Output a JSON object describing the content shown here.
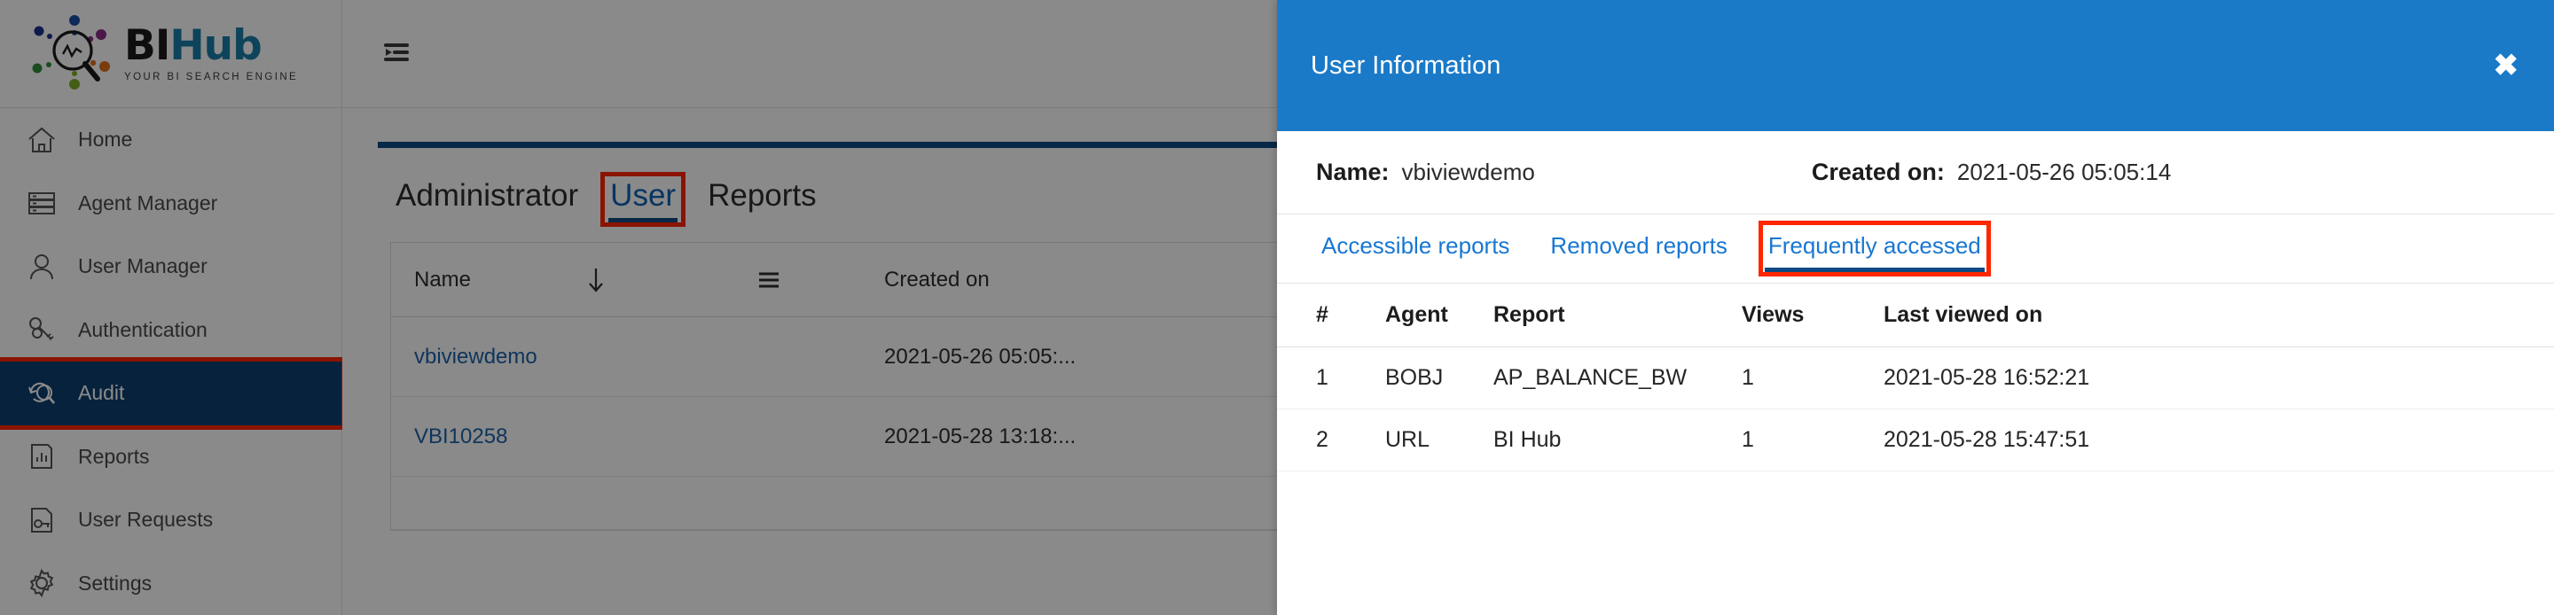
{
  "brand": {
    "name_bi": "BI",
    "name_hub": "Hub",
    "tagline": "YOUR BI SEARCH ENGINE",
    "logo_icon": "magnifier-analytics-icon"
  },
  "colors": {
    "accent_blue": "#1a7ac8",
    "nav_active": "#0e3f70",
    "rule_blue": "#0e4a84",
    "link_blue": "#1d63ab",
    "highlight_red": "#ff2600"
  },
  "topbar": {
    "menu_icon": "menu-collapse-icon"
  },
  "sidebar": {
    "items": [
      {
        "label": "Home",
        "icon": "home-icon",
        "active": false
      },
      {
        "label": "Agent Manager",
        "icon": "server-rack-icon",
        "active": false
      },
      {
        "label": "User Manager",
        "icon": "user-icon",
        "active": false
      },
      {
        "label": "Authentication",
        "icon": "keys-icon",
        "active": false
      },
      {
        "label": "Audit",
        "icon": "audit-search-icon",
        "active": true
      },
      {
        "label": "Reports",
        "icon": "report-chart-icon",
        "active": false
      },
      {
        "label": "User Requests",
        "icon": "document-key-icon",
        "active": false
      },
      {
        "label": "Settings",
        "icon": "gear-icon",
        "active": false
      }
    ]
  },
  "main": {
    "tabs": [
      {
        "label": "Administrator",
        "style": "plain",
        "selected": false,
        "highlighted": false
      },
      {
        "label": "User",
        "style": "link",
        "selected": true,
        "highlighted": true
      },
      {
        "label": "Reports",
        "style": "plain",
        "selected": false,
        "highlighted": false
      }
    ],
    "table": {
      "headers": {
        "name": "Name",
        "sort_icon": "sort-down-arrow-icon",
        "menu_icon": "hamburger-filter-icon",
        "created_on": "Created on"
      },
      "rows": [
        {
          "name": "vbiviewdemo",
          "created_on": "2021-05-26 05:05:..."
        },
        {
          "name": "VBI10258",
          "created_on": "2021-05-28 13:18:..."
        }
      ]
    }
  },
  "modal": {
    "title": "User Information",
    "close_icon": "close-icon",
    "name_label": "Name:",
    "name_value": "vbiviewdemo",
    "created_label": "Created on:",
    "created_value": "2021-05-26 05:05:14",
    "tabs": [
      {
        "label": "Accessible reports",
        "active": false,
        "highlighted": false
      },
      {
        "label": "Removed reports",
        "active": false,
        "highlighted": false
      },
      {
        "label": "Frequently accessed",
        "active": true,
        "highlighted": true
      }
    ],
    "table": {
      "headers": [
        "#",
        "Agent",
        "Report",
        "Views",
        "Last viewed on"
      ],
      "rows": [
        {
          "idx": "1",
          "agent": "BOBJ",
          "report": "AP_BALANCE_BW",
          "views": "1",
          "last_viewed": "2021-05-28 16:52:21"
        },
        {
          "idx": "2",
          "agent": "URL",
          "report": "BI Hub",
          "views": "1",
          "last_viewed": "2021-05-28 15:47:51"
        }
      ]
    }
  }
}
